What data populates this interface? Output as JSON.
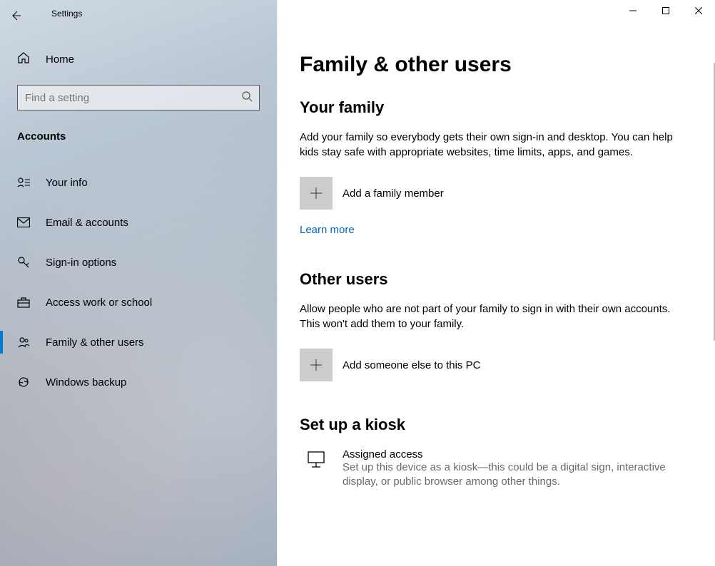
{
  "app_title": "Settings",
  "search": {
    "placeholder": "Find a setting"
  },
  "home_label": "Home",
  "section_label": "Accounts",
  "nav": [
    {
      "label": "Your info"
    },
    {
      "label": "Email & accounts"
    },
    {
      "label": "Sign-in options"
    },
    {
      "label": "Access work or school"
    },
    {
      "label": "Family & other users"
    },
    {
      "label": "Windows backup"
    }
  ],
  "page_title": "Family & other users",
  "family": {
    "heading": "Your family",
    "body": "Add your family so everybody gets their own sign-in and desktop. You can help kids stay safe with appropriate websites, time limits, apps, and games.",
    "add_label": "Add a family member",
    "learn_more": "Learn more"
  },
  "others": {
    "heading": "Other users",
    "body": "Allow people who are not part of your family to sign in with their own accounts. This won't add them to your family.",
    "add_label": "Add someone else to this PC"
  },
  "kiosk": {
    "heading": "Set up a kiosk",
    "item_title": "Assigned access",
    "item_desc": "Set up this device as a kiosk—this could be a digital sign, interactive display, or public browser among other things."
  }
}
